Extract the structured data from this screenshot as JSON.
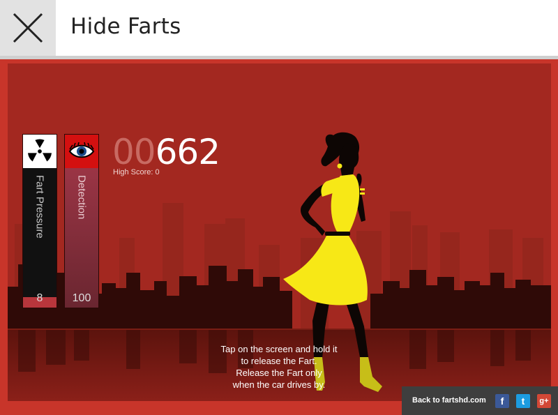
{
  "header": {
    "title": "Hide Farts",
    "close_icon": "close-icon"
  },
  "hud": {
    "fart_pressure": {
      "label": "Fart Pressure",
      "value": "8",
      "icon": "radiation-icon",
      "fill_fraction": 0.06
    },
    "detection": {
      "label": "Detection",
      "value": "100",
      "icon": "eye-icon"
    },
    "score": {
      "padding": "00",
      "value": "662"
    },
    "high_score": "High Score: 0"
  },
  "instructions": [
    "Tap on the screen and hold it",
    "to release the Fart.",
    "Release the Fart only",
    "when the car drives by."
  ],
  "footer": {
    "back_link": "Back to fartshd.com",
    "social": [
      {
        "name": "facebook-icon",
        "glyph": "f"
      },
      {
        "name": "twitter-icon",
        "glyph": "t"
      },
      {
        "name": "google-plus-icon",
        "glyph": "g+"
      }
    ]
  },
  "colors": {
    "frame": "#c8352a",
    "sky": "#a32820",
    "dress": "#f7e816",
    "silhouette": "#0d0604",
    "detection_icon_bg": "#d41010"
  }
}
